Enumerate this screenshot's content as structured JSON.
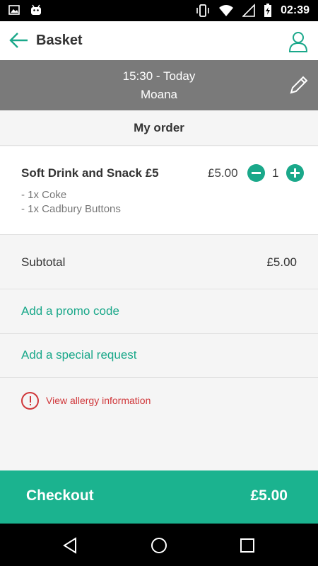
{
  "status_bar": {
    "time": "02:39",
    "icons": [
      "image-icon",
      "android-icon",
      "vibrate-icon",
      "wifi-icon",
      "signal-icon",
      "battery-charging-icon"
    ]
  },
  "app_bar": {
    "title": "Basket",
    "back_icon": "arrow-left-icon",
    "profile_icon": "person-icon"
  },
  "session": {
    "time": "15:30 - Today",
    "film": "Moana",
    "edit_icon": "pencil-icon"
  },
  "order": {
    "header": "My order",
    "items": [
      {
        "name": "Soft Drink and Snack £5",
        "price": "£5.00",
        "quantity": "1",
        "details": [
          "- 1x Coke",
          "- 1x Cadbury Buttons"
        ]
      }
    ],
    "subtotal_label": "Subtotal",
    "subtotal_value": "£5.00"
  },
  "links": {
    "promo": "Add a promo code",
    "special_request": "Add a special request",
    "allergy": "View allergy information"
  },
  "checkout": {
    "label": "Checkout",
    "total": "£5.00"
  },
  "colors": {
    "accent": "#1aa88a",
    "checkout_bg": "#1bb38f",
    "session_bg": "#7a7a7a",
    "warning": "#d0383b"
  }
}
